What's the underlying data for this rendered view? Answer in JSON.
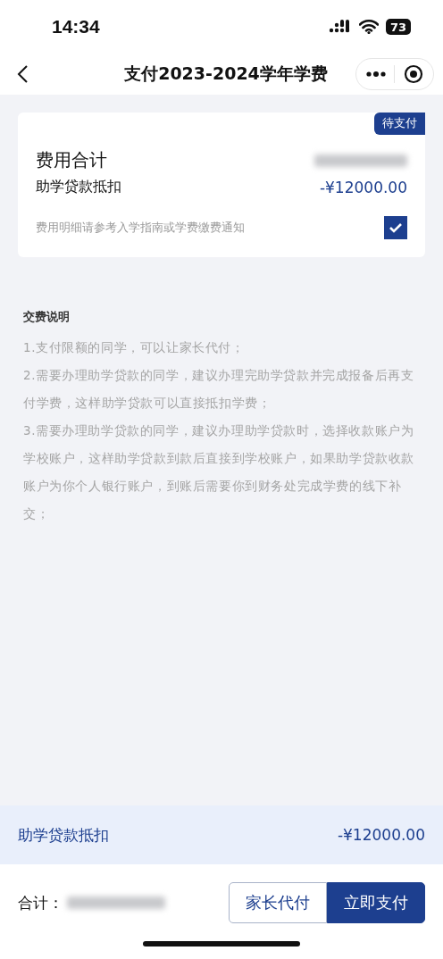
{
  "status_bar": {
    "time": "14:34",
    "battery": "73"
  },
  "nav": {
    "title": "支付2023-2024学年学费"
  },
  "fee_card": {
    "badge": "待支付",
    "total_label": "费用合计",
    "total_redacted": true,
    "loan_label": "助学贷款抵扣",
    "loan_amount": "-¥12000.00",
    "note": "费用明细请参考入学指南或学费缴费通知",
    "checked": true
  },
  "instructions": {
    "title": "交费说明",
    "items": [
      "1.支付限额的同学，可以让家长代付；",
      "2.需要办理助学贷款的同学，建议办理完助学贷款并完成报备后再支付学费，这样助学贷款可以直接抵扣学费；",
      "3.需要办理助学贷款的同学，建议办理助学贷款时，选择收款账户为学校账户，这样助学贷款到款后直接到学校账户，如果助学贷款收款账户为你个人银行账户，到账后需要你到财务处完成学费的线下补交；"
    ]
  },
  "deduction_bar": {
    "label": "助学贷款抵扣",
    "amount": "-¥12000.00"
  },
  "footer": {
    "total_label": "合计：",
    "total_redacted": true,
    "buttons": [
      {
        "label": "家长代付",
        "kind": "secondary"
      },
      {
        "label": "立即支付",
        "kind": "primary"
      }
    ]
  }
}
